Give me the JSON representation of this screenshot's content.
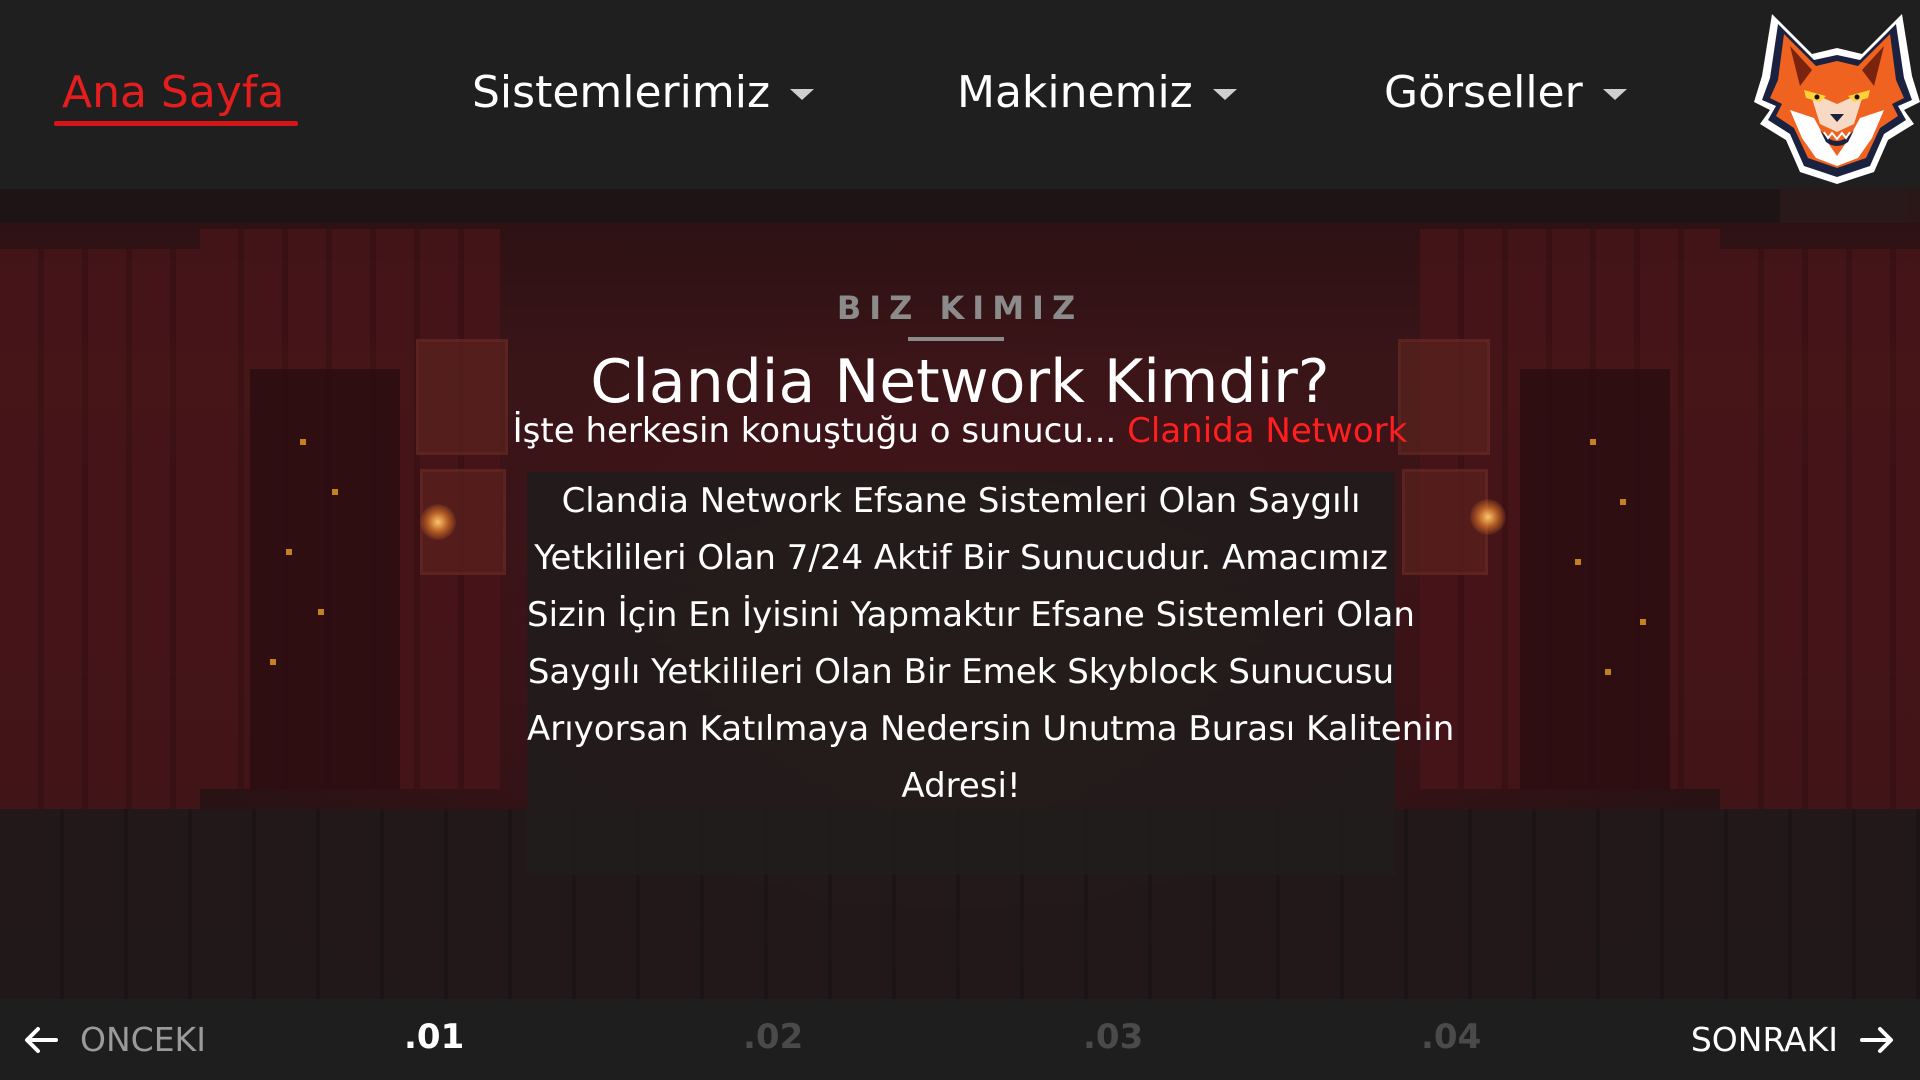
{
  "nav": {
    "items": [
      {
        "label": "Ana Sayfa",
        "active": true,
        "has_dropdown": false
      },
      {
        "label": "Sistemlerimiz",
        "active": false,
        "has_dropdown": true
      },
      {
        "label": "Makinemiz",
        "active": false,
        "has_dropdown": true
      },
      {
        "label": "Görseller",
        "active": false,
        "has_dropdown": true
      }
    ],
    "logo_icon": "fox-mascot-icon"
  },
  "hero": {
    "eyebrow": "BIZ KIMIZ",
    "title": "Clandia Network Kimdir?",
    "subtitle_prefix": "İşte herkesin konuştuğu o sunucu...",
    "subtitle_accent": "Clanida Network",
    "description_lines": [
      "Clandia Network Efsane Sistemleri Olan Saygılı",
      "Yetkilileri Olan 7/24 Aktif Bir Sunucudur. Amacımız",
      "Sizin İçin En İyisini Yapmaktır Efsane Sistemleri Olan",
      "Saygılı Yetkilileri Olan Bir Emek Skyblock Sunucusu",
      "Arıyorsan Katılmaya Nedersin Unutma Burası Kalitenin",
      "Adresi!"
    ]
  },
  "pager": {
    "prev_label": "ONCEKI",
    "next_label": "SONRAKI",
    "pages": [
      ".01",
      ".02",
      ".03",
      ".04"
    ],
    "current_page": ".01"
  },
  "colors": {
    "accent": "#e51d1d",
    "nav_bg": "#1f1f1f",
    "text": "#ffffff",
    "muted": "#8b8b8b"
  }
}
